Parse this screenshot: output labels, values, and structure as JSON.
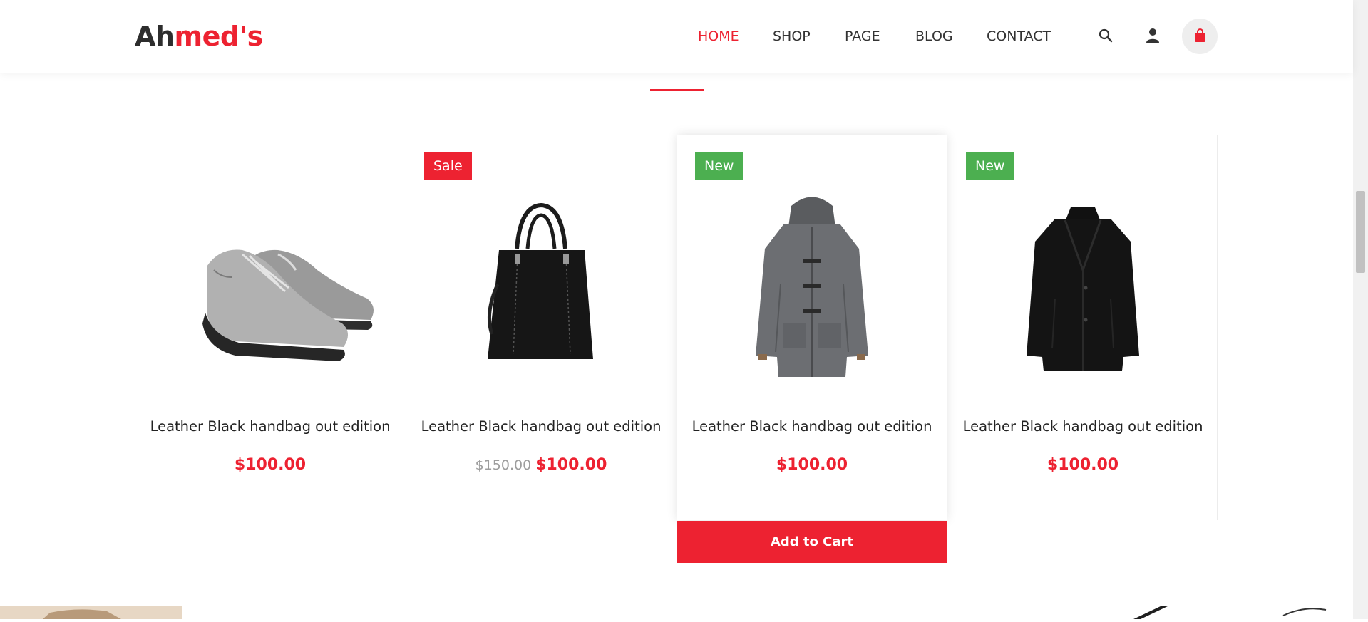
{
  "brand": {
    "part1": "Ah",
    "part2": "med's"
  },
  "nav": [
    "HOME",
    "SHOP",
    "PAGE",
    "BLOG",
    "CONTACT"
  ],
  "nav_active": "HOME",
  "icons": {
    "search": "search-icon",
    "user": "user-icon",
    "cart": "shopping-bag-icon"
  },
  "colors": {
    "accent": "#ed2231",
    "new_badge": "#4caf50",
    "text": "#2b2b2b"
  },
  "products": [
    {
      "badge": "",
      "title": "Leather Black handbag out edition",
      "old_price": "",
      "price": "$100.00",
      "image": "gray-sneakers"
    },
    {
      "badge": "Sale",
      "title": "Leather Black handbag out edition",
      "old_price": "$150.00",
      "price": "$100.00",
      "image": "black-leather-tote-bag"
    },
    {
      "badge": "New",
      "title": "Leather Black handbag out edition",
      "old_price": "",
      "price": "$100.00",
      "image": "gray-duffle-coat"
    },
    {
      "badge": "New",
      "title": "Leather Black handbag out edition",
      "old_price": "",
      "price": "$100.00",
      "image": "black-overcoat"
    }
  ],
  "add_to_cart": "Add to Cart"
}
